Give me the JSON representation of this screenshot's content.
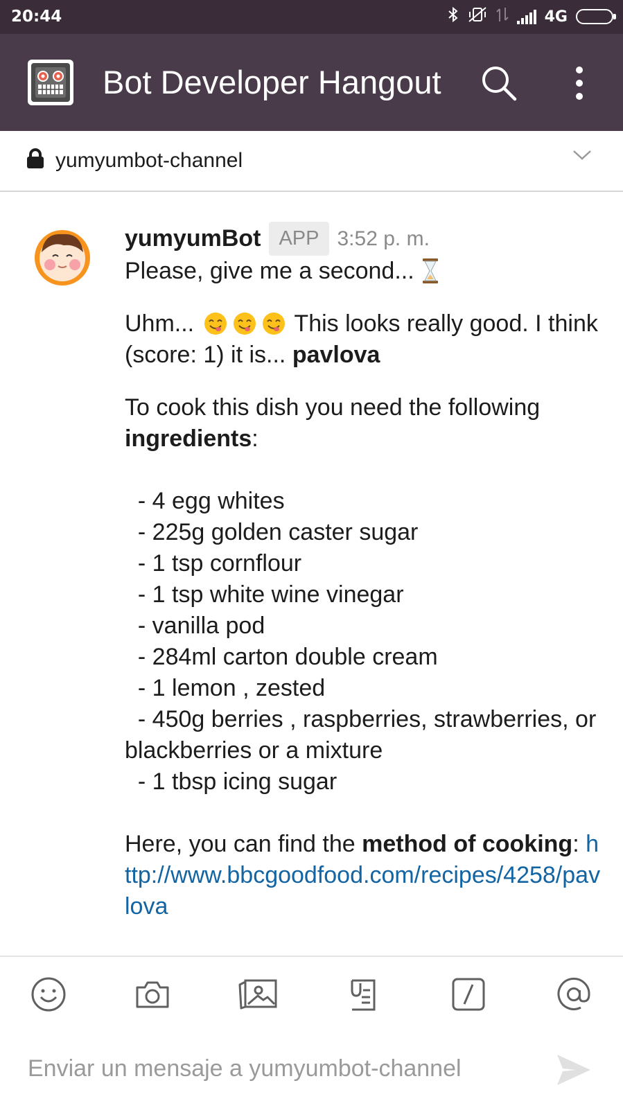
{
  "status_bar": {
    "time": "20:44",
    "network": "4G"
  },
  "app_bar": {
    "title": "Bot Developer Hangout"
  },
  "channel": {
    "name": "yumyumbot-channel"
  },
  "message": {
    "author": "yumyumBot",
    "tag": "APP",
    "timestamp": "3:52 p. m.",
    "line1": "Please, give me a second...",
    "line2_a": "Uhm...",
    "line2_b": "This looks really good. I think (score: 1) it is...",
    "dish": "pavlova",
    "line3_a": "To cook this dish you need the following",
    "line3_bold": "ingredients",
    "line3_end": ":",
    "ingredients": [
      "  - 4 egg whites",
      "  - 225g golden caster sugar",
      "  - 1 tsp cornflour",
      "  - 1 tsp white wine vinegar",
      "  - vanilla pod",
      "  - 284ml carton double cream",
      "  - 1 lemon , zested",
      "  - 450g berries , raspberries, strawberries, or blackberries or a mixture",
      "  - 1 tbsp icing sugar"
    ],
    "line4_a": "Here, you can find the",
    "line4_bold": "method of cooking",
    "line4_sep": ":",
    "link": "http://www.bbcgoodfood.com/recipes/4258/pavlova"
  },
  "toolbar": {
    "icons": [
      "emoji-icon",
      "camera-icon",
      "gallery-icon",
      "file-icon",
      "slash-command-icon",
      "mention-icon"
    ]
  },
  "composer": {
    "placeholder": "Enviar un mensaje a yumyumbot-channel"
  },
  "colors": {
    "status_bar": "#3a2c39",
    "app_bar": "#4a3b4a",
    "link": "#1264a3",
    "muted": "#8a8a8a"
  }
}
